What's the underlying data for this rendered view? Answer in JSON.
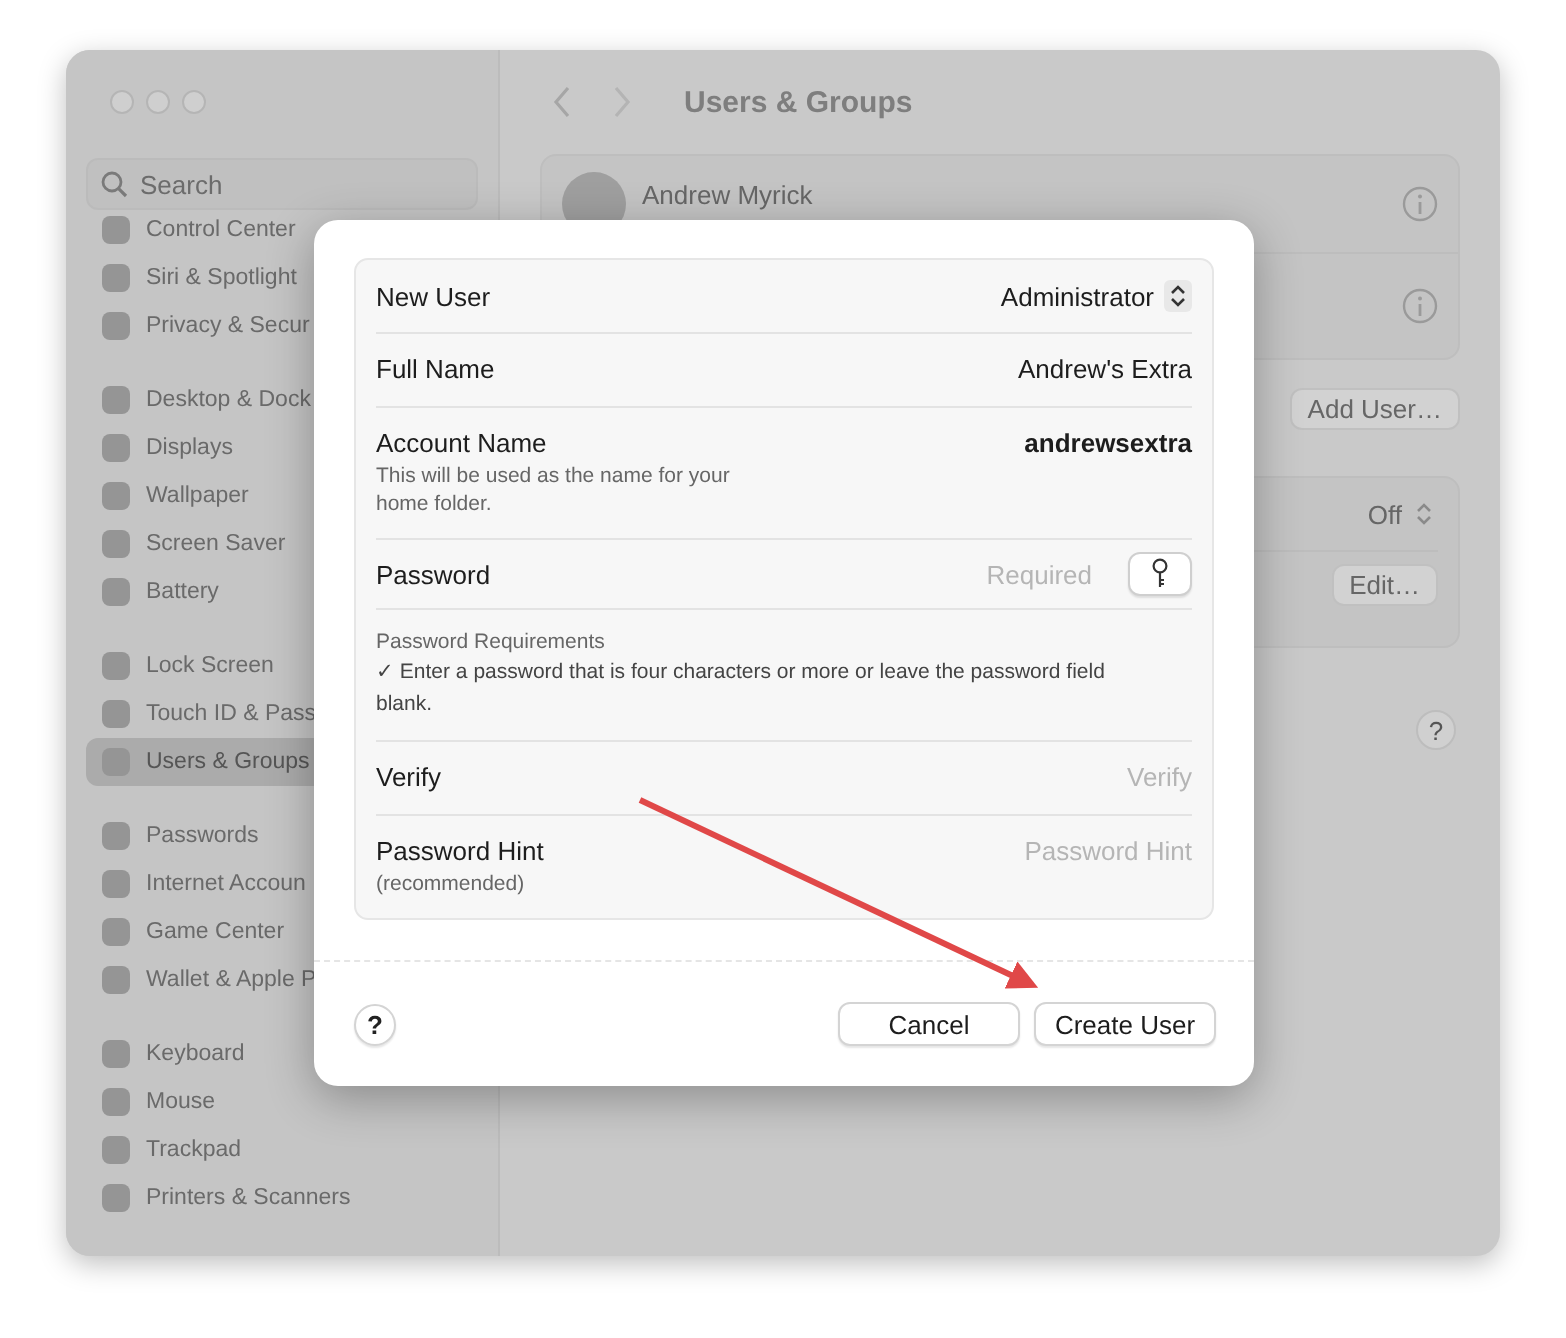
{
  "window": {
    "title": "Users & Groups"
  },
  "sidebar": {
    "search": {
      "placeholder": "Search"
    },
    "groups": [
      {
        "items": [
          {
            "label": "Control Center",
            "selected": false
          },
          {
            "label": "Siri & Spotlight",
            "selected": false
          },
          {
            "label": "Privacy & Secur",
            "selected": false
          }
        ]
      },
      {
        "items": [
          {
            "label": "Desktop & Dock",
            "selected": false
          },
          {
            "label": "Displays",
            "selected": false
          },
          {
            "label": "Wallpaper",
            "selected": false
          },
          {
            "label": "Screen Saver",
            "selected": false
          },
          {
            "label": "Battery",
            "selected": false
          }
        ]
      },
      {
        "items": [
          {
            "label": "Lock Screen",
            "selected": false
          },
          {
            "label": "Touch ID & Pass",
            "selected": false
          },
          {
            "label": "Users & Groups",
            "selected": true
          }
        ]
      },
      {
        "items": [
          {
            "label": "Passwords",
            "selected": false
          },
          {
            "label": "Internet Accoun",
            "selected": false
          },
          {
            "label": "Game Center",
            "selected": false
          },
          {
            "label": "Wallet & Apple P",
            "selected": false
          }
        ]
      },
      {
        "items": [
          {
            "label": "Keyboard",
            "selected": false
          },
          {
            "label": "Mouse",
            "selected": false
          },
          {
            "label": "Trackpad",
            "selected": false
          },
          {
            "label": "Printers & Scanners",
            "selected": false
          }
        ]
      }
    ]
  },
  "content": {
    "user": {
      "name": "Andrew Myrick"
    },
    "add_button": "Add User…",
    "setting": {
      "value": "Off"
    },
    "edit_button": "Edit…",
    "help_button": "?"
  },
  "dialog": {
    "rows": [
      {
        "kind": "select",
        "label": "New User",
        "value": "Administrator"
      },
      {
        "kind": "value",
        "label": "Full Name",
        "value": "Andrew's Extra"
      },
      {
        "kind": "value",
        "label": "Account Name",
        "note": "This will be used as the name for your home folder.",
        "value": "andrewsextra"
      },
      {
        "kind": "password",
        "label": "Password",
        "placeholder": "Required"
      },
      {
        "kind": "info",
        "title": "Password Requirements",
        "text": "✓ Enter a password that is four characters or more or leave the password field blank."
      },
      {
        "kind": "field",
        "label": "Verify",
        "placeholder": "Verify"
      },
      {
        "kind": "field",
        "label": "Password Hint",
        "note": "(recommended)",
        "placeholder": "Password Hint"
      }
    ],
    "help_button": "?",
    "buttons": [
      "Cancel",
      "Create User"
    ]
  }
}
